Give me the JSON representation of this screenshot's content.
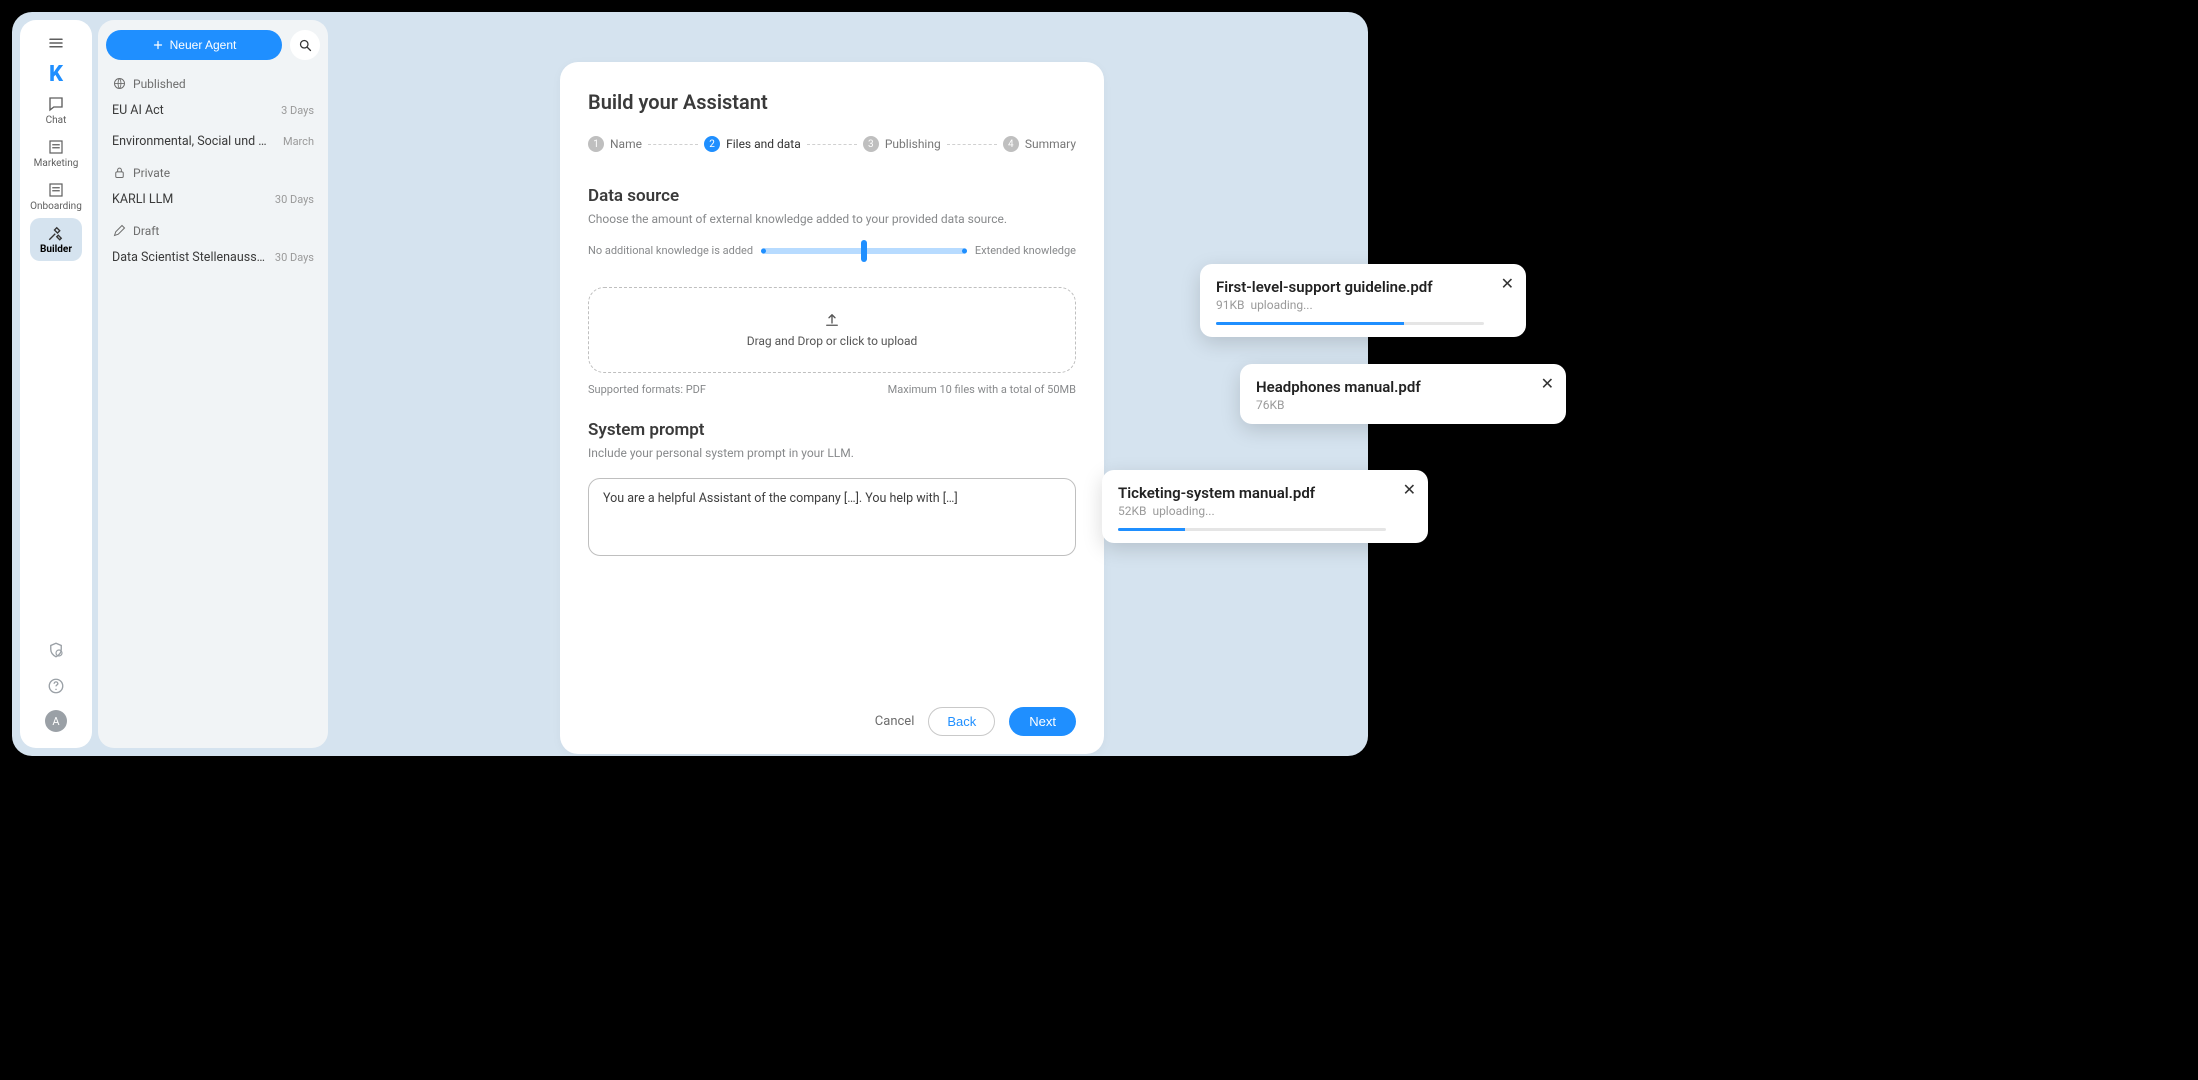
{
  "rail": {
    "logo": "K",
    "items": [
      {
        "key": "chat",
        "label": "Chat"
      },
      {
        "key": "marketing",
        "label": "Marketing"
      },
      {
        "key": "onboarding",
        "label": "Onboarding"
      },
      {
        "key": "builder",
        "label": "Builder"
      }
    ],
    "avatar_letter": "A"
  },
  "list": {
    "new_agent": "Neuer Agent",
    "sections": [
      {
        "title": "Published",
        "items": [
          {
            "name": "EU AI Act",
            "meta": "3 Days"
          },
          {
            "name": "Environmental, Social und Gover",
            "meta": "March"
          }
        ]
      },
      {
        "title": "Private",
        "items": [
          {
            "name": "KARLI LLM",
            "meta": "30 Days"
          }
        ]
      },
      {
        "title": "Draft",
        "items": [
          {
            "name": "Data Scientist Stellenausschreib",
            "meta": "30 Days"
          }
        ]
      }
    ]
  },
  "modal": {
    "title": "Build your Assistant",
    "steps": [
      "Name",
      "Files and data",
      "Publishing",
      "Summary"
    ],
    "active_step": 2,
    "datasource": {
      "heading": "Data source",
      "hint": "Choose the amount of external knowledge added to your provided data source.",
      "slider_left": "No additional knowledge is added",
      "slider_right": "Extended knowledge",
      "dropzone": "Drag and Drop or click to upload",
      "supported": "Supported formats: PDF",
      "max": "Maximum 10 files with a total of 50MB"
    },
    "sysprompt": {
      "heading": "System prompt",
      "hint": "Include your personal system prompt in your LLM.",
      "value": "You are a helpful Assistant of the company […]. You help with […]"
    },
    "footer": {
      "cancel": "Cancel",
      "back": "Back",
      "next": "Next"
    }
  },
  "uploads": [
    {
      "name": "First-level-support guideline.pdf",
      "size": "91KB",
      "status": "uploading...",
      "progress": 70
    },
    {
      "name": "Headphones manual.pdf",
      "size": "76KB",
      "status": "",
      "progress": null
    },
    {
      "name": "Ticketing-system manual.pdf",
      "size": "52KB",
      "status": "uploading...",
      "progress": 25
    }
  ]
}
